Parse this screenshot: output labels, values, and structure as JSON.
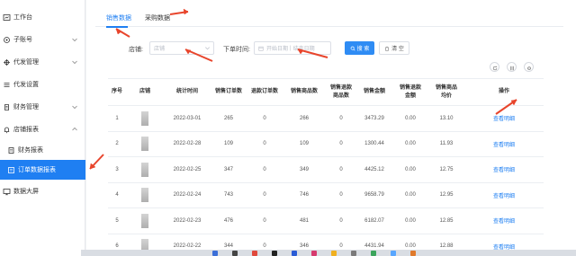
{
  "sidebar": {
    "items": [
      {
        "label": "工作台",
        "icon": "dashboard-icon",
        "chevron": false
      },
      {
        "label": "子账号",
        "icon": "account-icon",
        "chevron": true
      },
      {
        "label": "代发管理",
        "icon": "dispatch-icon",
        "chevron": true
      },
      {
        "label": "代发设置",
        "icon": "settings-icon",
        "chevron": false
      },
      {
        "label": "财务管理",
        "icon": "finance-icon",
        "chevron": true
      },
      {
        "label": "店铺报表",
        "icon": "bell-icon",
        "chevron": true
      },
      {
        "label": "财务报表",
        "icon": "report-icon",
        "chevron": false
      },
      {
        "label": "订单数据报表",
        "icon": "order-report-icon",
        "chevron": false
      },
      {
        "label": "数据大屏",
        "icon": "screen-icon",
        "chevron": false
      }
    ]
  },
  "tabs": [
    {
      "label": "销售数据"
    },
    {
      "label": "采购数据"
    }
  ],
  "filters": {
    "store_label": "店铺:",
    "store_placeholder": "店铺",
    "order_time_label": "下单时间:",
    "date_start_placeholder": "开始日期",
    "date_end_placeholder": "结束日期",
    "search_button": "搜 索",
    "clear_button": "清 空"
  },
  "table": {
    "headers": [
      "序号",
      "店铺",
      "统计时间",
      "销售订单数",
      "退款订单数",
      "销售商品数",
      "销售退款商品数",
      "销售金额",
      "销售退款金额",
      "销售商品均价",
      "操作"
    ],
    "rows": [
      {
        "index": "1",
        "date": "2022-03-01",
        "orders": "265",
        "refund_orders": "0",
        "items": "266",
        "refund_items": "0",
        "amount": "3473.29",
        "refund_amount": "0.00",
        "avg_price": "13.10",
        "action": "查看明细"
      },
      {
        "index": "2",
        "date": "2022-02-28",
        "orders": "109",
        "refund_orders": "0",
        "items": "109",
        "refund_items": "0",
        "amount": "1300.44",
        "refund_amount": "0.00",
        "avg_price": "11.93",
        "action": "查看明细"
      },
      {
        "index": "3",
        "date": "2022-02-25",
        "orders": "347",
        "refund_orders": "0",
        "items": "349",
        "refund_items": "0",
        "amount": "4425.12",
        "refund_amount": "0.00",
        "avg_price": "12.75",
        "action": "查看明细"
      },
      {
        "index": "4",
        "date": "2022-02-24",
        "orders": "743",
        "refund_orders": "0",
        "items": "746",
        "refund_items": "0",
        "amount": "9658.79",
        "refund_amount": "0.00",
        "avg_price": "12.95",
        "action": "查看明细"
      },
      {
        "index": "5",
        "date": "2022-02-23",
        "orders": "476",
        "refund_orders": "0",
        "items": "481",
        "refund_items": "0",
        "amount": "6182.07",
        "refund_amount": "0.00",
        "avg_price": "12.85",
        "action": "查看明细"
      },
      {
        "index": "6",
        "date": "2022-02-22",
        "orders": "344",
        "refund_orders": "0",
        "items": "346",
        "refund_items": "0",
        "amount": "4431.94",
        "refund_amount": "0.00",
        "avg_price": "12.88",
        "action": "查看明细"
      }
    ]
  },
  "colors": {
    "accent": "#1f7ff2",
    "annotation_arrow": "#e8452c"
  }
}
